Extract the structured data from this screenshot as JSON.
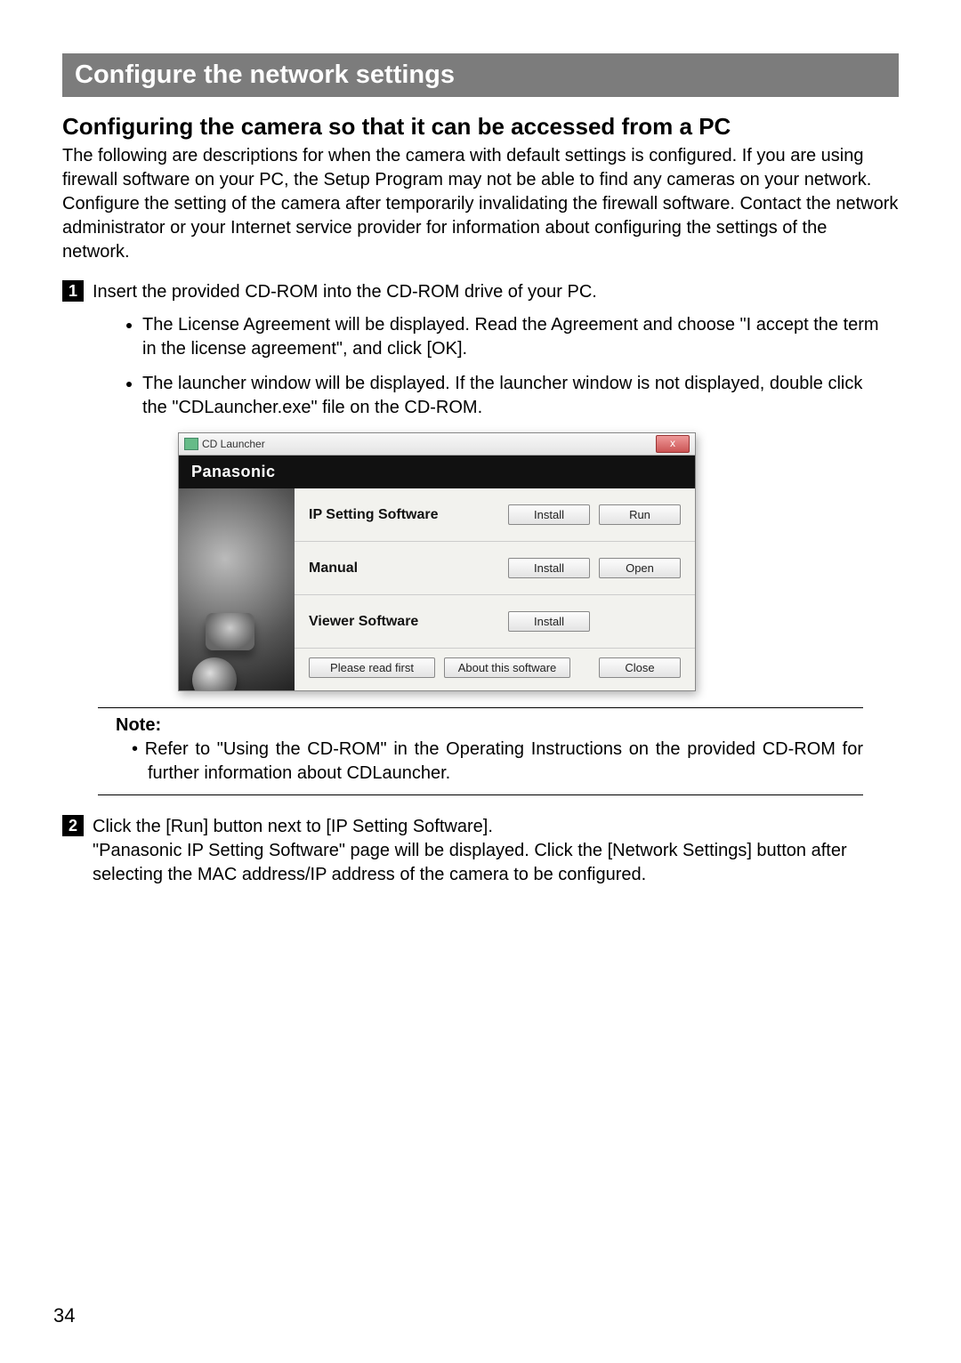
{
  "page_number": "34",
  "banner": "Configure the network settings",
  "subheading": "Configuring the camera so that it can be accessed from a PC",
  "intro": "The following are descriptions for when the camera with default settings is configured. If you are using firewall software on your PC, the Setup Program may not be able to find any cameras on your network. Configure the setting of the camera after temporarily invalidating the firewall software. Contact the network administrator or your Internet service provider for information about configuring the settings of the network.",
  "step1_num": "1",
  "step1_text": "Insert the provided CD-ROM into the CD-ROM drive of your PC.",
  "step1_bullets": [
    "The License Agreement will be displayed. Read the Agreement and choose \"I accept the term in the license agreement\", and click [OK].",
    "The launcher window will be displayed. If the launcher window is not displayed, double click the \"CDLauncher.exe\" file on the CD-ROM."
  ],
  "launcher": {
    "title": "CD Launcher",
    "close_glyph": "x",
    "brand": "Panasonic",
    "rows": [
      {
        "label": "IP Setting Software",
        "btn1": "Install",
        "btn2": "Run"
      },
      {
        "label": "Manual",
        "btn1": "Install",
        "btn2": "Open"
      },
      {
        "label": "Viewer Software",
        "btn1": "Install",
        "btn2": ""
      }
    ],
    "footer": {
      "read_first": "Please read first",
      "about": "About this software",
      "close": "Close"
    }
  },
  "note_title": "Note:",
  "note_item": "Refer to \"Using the CD-ROM\" in the Operating Instructions on the provided CD-ROM for further information about CDLauncher.",
  "step2_num": "2",
  "step2_line1": "Click the [Run] button next to [IP Setting Software].",
  "step2_line2": "\"Panasonic IP Setting Software\" page will be displayed. Click the [Network Settings] button after selecting the MAC address/IP address of the camera to be configured."
}
